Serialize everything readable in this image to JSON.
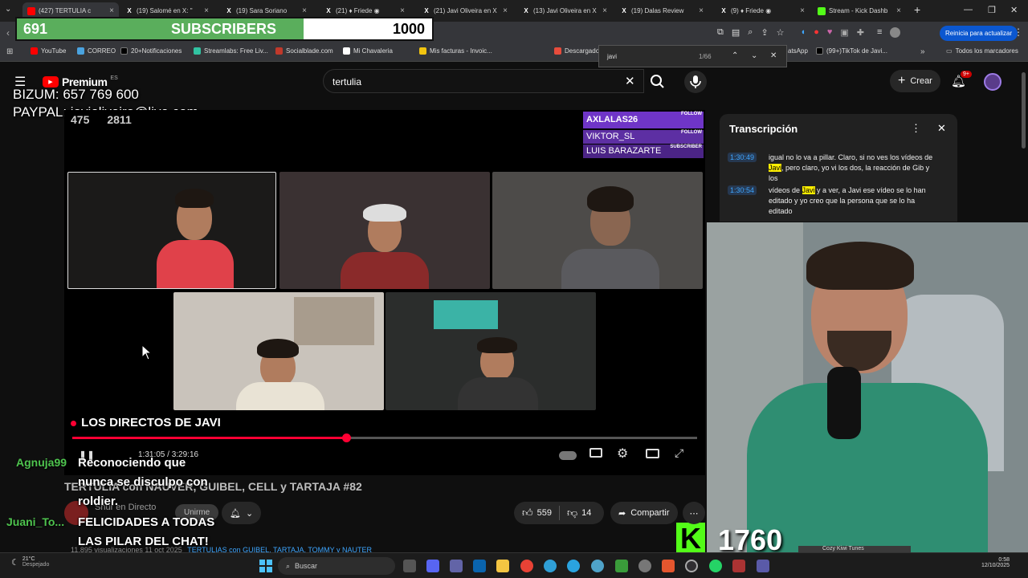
{
  "browser": {
    "tabs": [
      {
        "title": "(427) TERTULIA c",
        "color": "#ff0000"
      },
      {
        "title": "(19) Salomé en X: \"",
        "color": "#000000"
      },
      {
        "title": "(19) Sara Soriano",
        "color": "#000000"
      },
      {
        "title": "(21) ♦ Friede ◉",
        "color": "#000000"
      },
      {
        "title": "(21) Javi Oliveira en X",
        "color": "#000000"
      },
      {
        "title": "(13) Javi Oliveira en X",
        "color": "#000000"
      },
      {
        "title": "(19) Dalas Review",
        "color": "#000000"
      },
      {
        "title": "(9) ♦ Friede ◉",
        "color": "#000000"
      },
      {
        "title": "Stream - Kick Dashb",
        "color": "#53fc18"
      }
    ],
    "new_tab": "+",
    "update_button": "Reinicia para actualizar",
    "bookmarks": [
      {
        "label": "YouTube",
        "color": "#ff0000"
      },
      {
        "label": "CORREO",
        "color": "#4aa3df"
      },
      {
        "label": "20+Notificaciones",
        "color": "#000000"
      },
      {
        "label": "Streamlabs: Free Liv...",
        "color": "#31c3a2"
      },
      {
        "label": "Socialblade.com",
        "color": "#c0392b"
      },
      {
        "label": "Mi Chavaleria",
        "color": "#ffffff"
      },
      {
        "label": "Mis facturas - Invoic...",
        "color": "#f1c40f"
      },
      {
        "label": "Descargado",
        "color": "#e74c3c"
      },
      {
        "label": "atsApp",
        "color": "#25d366"
      },
      {
        "label": "(99+)TikTok de Javi...",
        "color": "#000000"
      }
    ],
    "all_bookmarks": "Todos los marcadores",
    "find": {
      "query": "javi",
      "count": "1/66"
    }
  },
  "subscribers": {
    "current": "691",
    "label": "SUBSCRIBERS",
    "goal": "1000",
    "progress": 0.691
  },
  "donation_overlay": {
    "bizum": "BIZUM: 657 769 600",
    "paypal": "PAYPAL: javioliveira@live.com",
    "viewers": "475",
    "yt_viewers": "2811"
  },
  "youtube": {
    "logo": "Premium",
    "region": "ES",
    "search_query": "tertulia",
    "create": "Crear",
    "notifications": "9+",
    "video_title": "TERTULIA con NAUVER, GUIBEL, CELL y TARTAJA #82",
    "time_current": "1:31:05",
    "time_total": "3:29:16",
    "progress": 0.438,
    "channel_status": "Shur en Directo",
    "join": "Unirme",
    "likes": "559",
    "dislikes": "14",
    "share": "Compartir",
    "views": "11.895 visualizaciones  11 oct 2025",
    "tags": "TERTULIAS con GUIBEL, TARTAJA, TOMMY y NAUTER"
  },
  "follow_alerts": [
    {
      "name": "AXLALAS26",
      "tag": "FOLLOW"
    },
    {
      "name": "VIKTOR_SL",
      "tag": "FOLLOW"
    },
    {
      "name": "LUIS BARAZARTE",
      "tag": "SUBSCRIBER"
    }
  ],
  "transcript": {
    "title": "Transcripción",
    "entries": [
      {
        "time": "1:30:49",
        "pre": "igual no lo va a pillar. Claro, si no ves los vídeos de ",
        "hl": "Javi",
        "post": ", pero claro, yo vi los dos, la reacción de Gib y los"
      },
      {
        "time": "1:30:54",
        "pre": "vídeos de ",
        "hl": "Javi",
        "post": " y a ver, a Javi ese vídeo se lo han editado y yo creo que la persona que se lo ha editado"
      }
    ]
  },
  "stream_overlay": {
    "directos": "LOS DIRECTOS DE JAVI",
    "kick_count": "1760",
    "music": "Cozy Kiwi Tunes"
  },
  "chat": [
    {
      "user": "Agnuja99",
      "color": "#4ec44e",
      "lines": [
        "Reconociendo que",
        "nunca se disculpo con",
        "roldier."
      ]
    },
    {
      "user": "Juani_To...",
      "color": "#4ec44e",
      "lines": [
        "FELICIDADES A TODAS",
        "LAS PILAR DEL CHAT!"
      ]
    }
  ],
  "taskbar": {
    "weather_temp": "21°C",
    "weather_desc": "Despejado",
    "search": "Buscar",
    "time": "0:58",
    "date": "12/10/2025"
  }
}
